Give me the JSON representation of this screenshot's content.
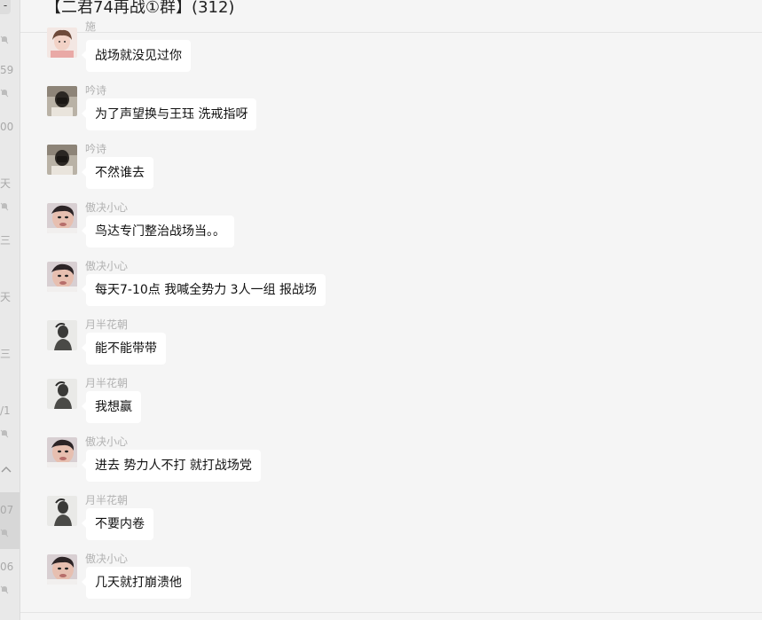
{
  "chat": {
    "title": "【二君74再战①群】(312)"
  },
  "left_list": {
    "fragments": [
      "59",
      "00",
      "天",
      "三",
      "天",
      "三",
      "/1",
      "07",
      "06"
    ],
    "top_button": "-"
  },
  "messages": [
    {
      "sender": "施",
      "text": "战场就没见过你",
      "avatar_type": "girl"
    },
    {
      "sender": "吟诗",
      "text": "为了声望换与王珏 洗戒指呀",
      "avatar_type": "mask"
    },
    {
      "sender": "吟诗",
      "text": "不然谁去",
      "avatar_type": "mask"
    },
    {
      "sender": "傲决小心",
      "text": "鸟达专门整治战场当。。",
      "avatar_type": "face"
    },
    {
      "sender": "傲决小心",
      "text": "每天7-10点 我喊全势力 3人一组 报战场",
      "avatar_type": "face"
    },
    {
      "sender": "月半花朝",
      "text": "能不能带带",
      "avatar_type": "silhouette"
    },
    {
      "sender": "月半花朝",
      "text": "我想赢",
      "avatar_type": "silhouette"
    },
    {
      "sender": "傲决小心",
      "text": "进去 势力人不打 就打战场党",
      "avatar_type": "face"
    },
    {
      "sender": "月半花朝",
      "text": "不要内卷",
      "avatar_type": "silhouette"
    },
    {
      "sender": "傲决小心",
      "text": "几天就打崩溃他",
      "avatar_type": "face"
    }
  ],
  "colors": {
    "background": "#f5f5f5",
    "bubble": "#ffffff",
    "sender_name": "#b2b2b2"
  }
}
